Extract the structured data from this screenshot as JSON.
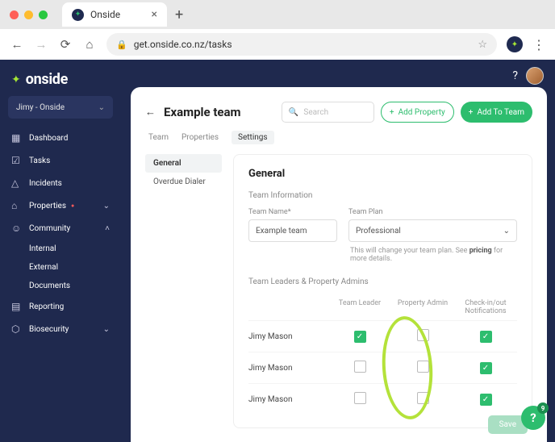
{
  "browser": {
    "tab_title": "Onside",
    "url": "get.onside.co.nz/tasks"
  },
  "app": {
    "logo_text": "onside",
    "org_selector": "Jimy - Onside",
    "nav": [
      {
        "icon": "grid",
        "label": "Dashboard"
      },
      {
        "icon": "clipboard",
        "label": "Tasks"
      },
      {
        "icon": "alert",
        "label": "Incidents"
      },
      {
        "icon": "home",
        "label": "Properties",
        "badge": true,
        "chev": "down"
      },
      {
        "icon": "users",
        "label": "Community",
        "chev": "up"
      },
      {
        "icon": "chart",
        "label": "Reporting"
      },
      {
        "icon": "shield",
        "label": "Biosecurity",
        "chev": "down"
      }
    ],
    "nav_sub": [
      "Internal",
      "External",
      "Documents"
    ]
  },
  "page": {
    "title": "Example team",
    "search_placeholder": "Search",
    "btn_add_property": "Add Property",
    "btn_add_to_team": "Add To Team",
    "tabs": [
      "Team",
      "Properties",
      "Settings"
    ],
    "active_tab": 2,
    "left_nav": [
      "General",
      "Overdue Dialer"
    ],
    "active_left": 0
  },
  "panel": {
    "heading": "General",
    "section1": "Team Information",
    "team_name_label": "Team Name*",
    "team_name_value": "Example team",
    "team_plan_label": "Team Plan",
    "team_plan_value": "Professional",
    "hint_pre": "This will change your team plan. See ",
    "hint_bold": "pricing",
    "hint_post": " for more details.",
    "section2": "Team Leaders & Property Admins",
    "cols": [
      "Team Leader",
      "Property Admin",
      "Check-in/out Notifications"
    ],
    "rows": [
      {
        "name": "Jimy Mason",
        "leader": true,
        "admin": false,
        "notif": true
      },
      {
        "name": "Jimy Mason",
        "leader": false,
        "admin": false,
        "notif": true
      },
      {
        "name": "Jimy Mason",
        "leader": false,
        "admin": false,
        "notif": true
      }
    ],
    "save_label": "Save"
  },
  "float_help_badge": "9"
}
